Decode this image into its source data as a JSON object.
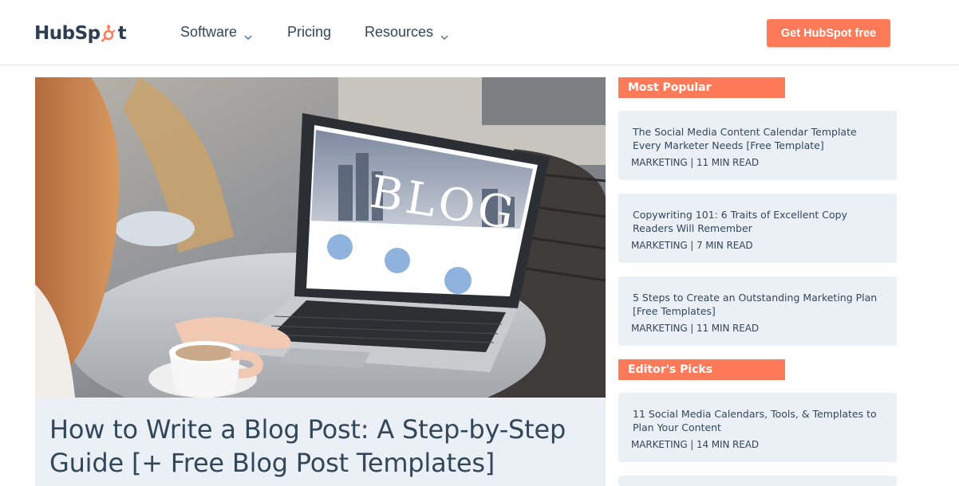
{
  "brand": {
    "logo_text_left": "HubSp",
    "logo_text_right": "t",
    "accent": "#ff7a59",
    "dark": "#33475b",
    "card_bg": "#eaf0f6"
  },
  "nav": {
    "items": [
      {
        "label": "Software",
        "has_dropdown": true
      },
      {
        "label": "Pricing",
        "has_dropdown": false
      },
      {
        "label": "Resources",
        "has_dropdown": true
      }
    ],
    "cta_label": "Get HubSpot free"
  },
  "hero": {
    "image_subject": "laptop showing BLOG on screen, woman with coffee cup",
    "screen_text": "BLOG",
    "title": "How to Write a Blog Post: A Step-by-Step Guide [+ Free Blog Post Templates]"
  },
  "sidebar": {
    "most_popular_label": "Most Popular",
    "most_popular": [
      {
        "title": "The Social Media Content Calendar Template Every Marketer Needs [Free Template]",
        "meta": "MARKETING | 11 MIN READ"
      },
      {
        "title": "Copywriting 101: 6 Traits of Excellent Copy Readers Will Remember",
        "meta": "MARKETING | 7 MIN READ"
      },
      {
        "title": "5 Steps to Create an Outstanding Marketing Plan [Free Templates]",
        "meta": "MARKETING | 11 MIN READ"
      }
    ],
    "editors_picks_label": "Editor's Picks",
    "editors_picks": [
      {
        "title": "11 Social Media Calendars, Tools, & Templates to Plan Your Content",
        "meta": "MARKETING | 14 MIN READ"
      }
    ]
  }
}
